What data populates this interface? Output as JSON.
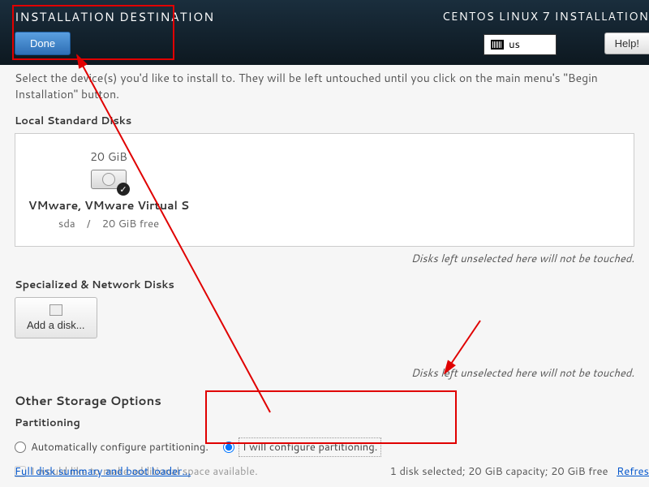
{
  "header": {
    "title": "INSTALLATION DESTINATION",
    "product": "CENTOS LINUX 7 INSTALLATION",
    "done_label": "Done",
    "lang": "us",
    "help_label": "Help!"
  },
  "intro": "Select the device(s) you'd like to install to.  They will be left untouched until you click on the main menu's \"Begin Installation\" button.",
  "local_disks": {
    "label": "Local Standard Disks",
    "disk": {
      "size": "20 GiB",
      "name": "VMware, VMware Virtual S",
      "device": "sda",
      "sep": "/",
      "free": "20 GiB free"
    },
    "note": "Disks left unselected here will not be touched."
  },
  "network_disks": {
    "label": "Specialized & Network Disks",
    "add_label": "Add a disk...",
    "note": "Disks left unselected here will not be touched."
  },
  "storage": {
    "title": "Other Storage Options",
    "partitioning_label": "Partitioning",
    "auto_label": "Automatically configure partitioning.",
    "manual_label": "I will configure partitioning.",
    "additional_label": "I would like to make additional space available."
  },
  "footer": {
    "summary_link": "Full disk summary and boot loader...",
    "status": "1 disk selected; 20 GiB capacity; 20 GiB free",
    "refresh": "Refres"
  }
}
